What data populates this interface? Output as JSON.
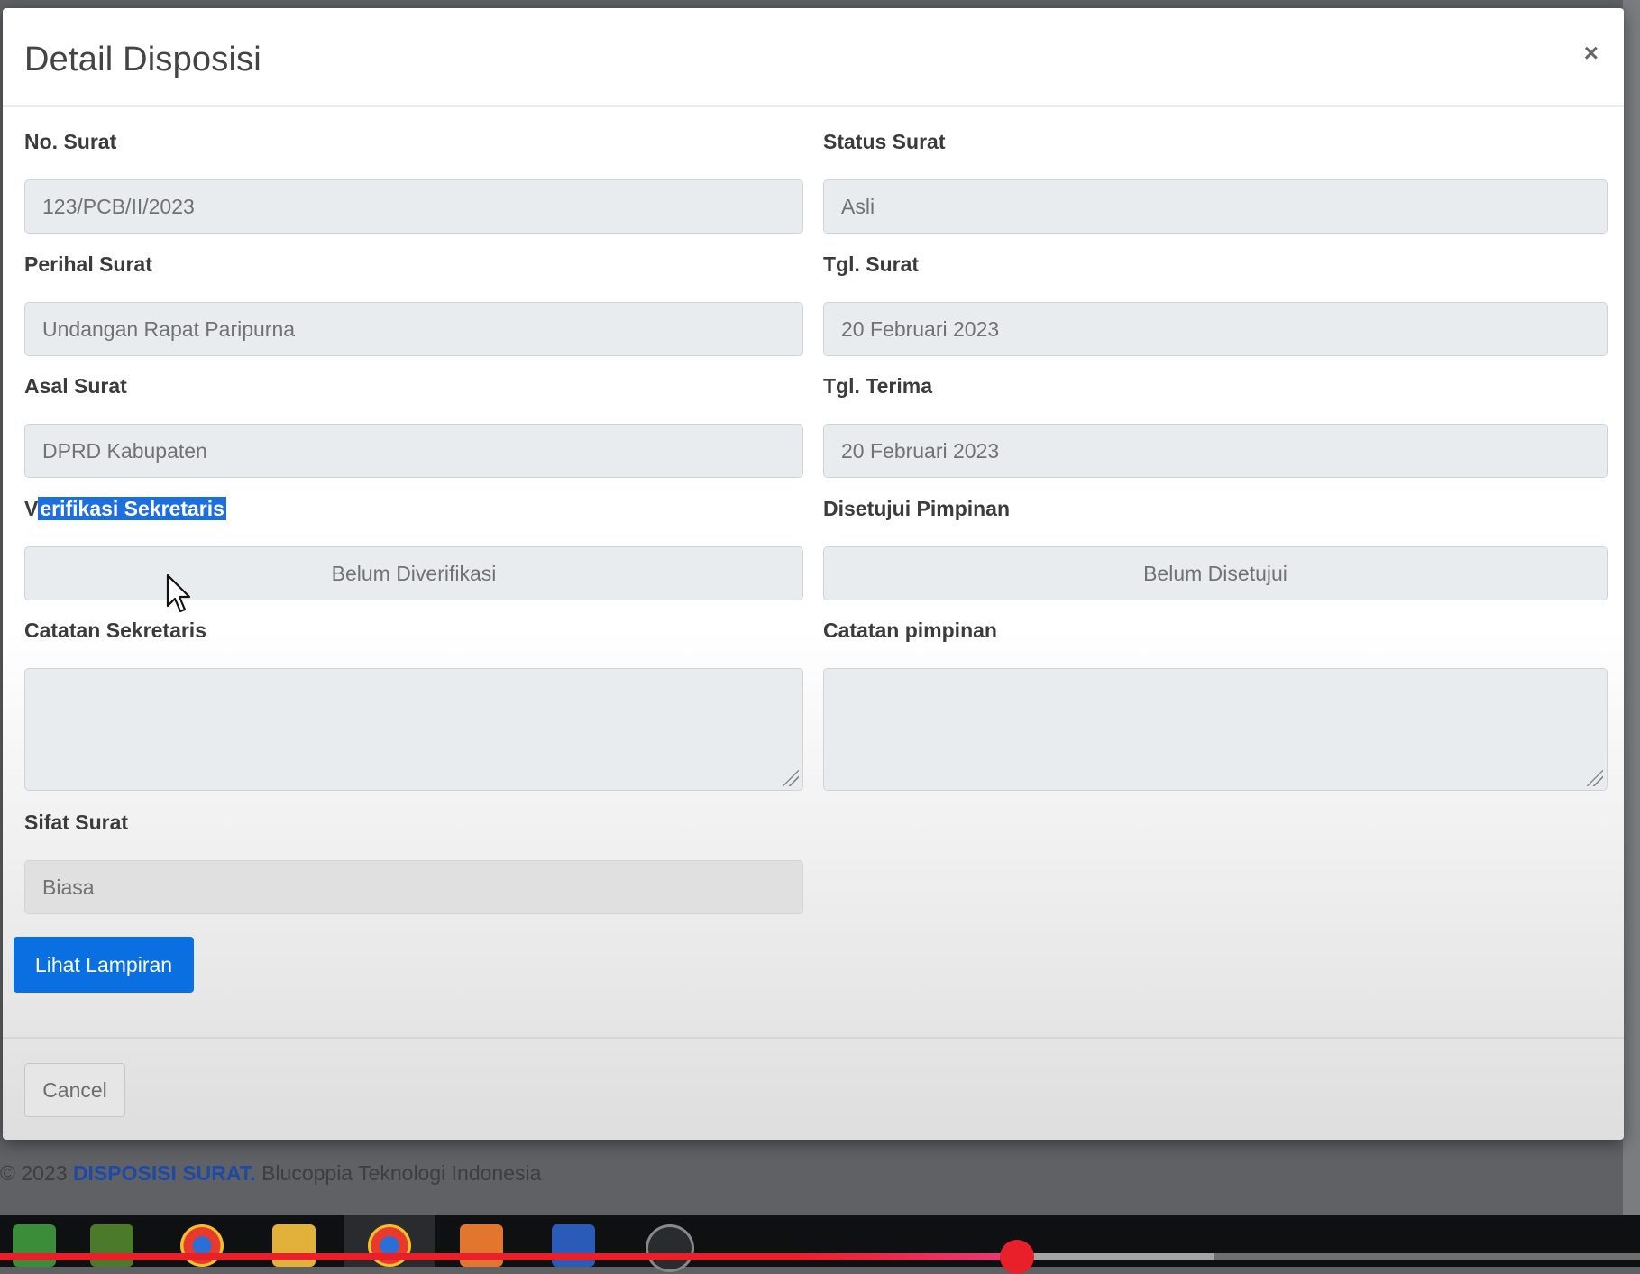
{
  "modal": {
    "title": "Detail Disposisi",
    "close_label": "×"
  },
  "fields": {
    "no_surat": {
      "label": "No. Surat",
      "value": "123/PCB/II/2023"
    },
    "status_surat": {
      "label": "Status Surat",
      "value": "Asli"
    },
    "perihal_surat": {
      "label": "Perihal Surat",
      "value": "Undangan Rapat Paripurna"
    },
    "tgl_surat": {
      "label": "Tgl. Surat",
      "value": "20 Februari 2023"
    },
    "asal_surat": {
      "label": "Asal Surat",
      "value": "DPRD Kabupaten"
    },
    "tgl_terima": {
      "label": "Tgl. Terima",
      "value": "20 Februari 2023"
    },
    "verifikasi_sekretaris": {
      "label_first": "V",
      "label_rest": "erifikasi Sekretaris",
      "value": "Belum Diverifikasi"
    },
    "disetujui_pimpinan": {
      "label": "Disetujui Pimpinan",
      "value": "Belum Disetujui"
    },
    "catatan_sekretaris": {
      "label": "Catatan Sekretaris",
      "value": ""
    },
    "catatan_pimpinan": {
      "label": "Catatan pimpinan",
      "value": ""
    },
    "sifat_surat": {
      "label": "Sifat Surat",
      "value": "Biasa"
    }
  },
  "buttons": {
    "lihat_lampiran": "Lihat Lampiran",
    "cancel": "Cancel"
  },
  "footer": {
    "copyright": "© 2023 ",
    "brand": "DISPOSISI SURAT.",
    "company": " Blucoppia Teknologi Indonesia"
  },
  "video": {
    "progress_fraction": 0.62,
    "buffered_fraction": 0.74
  },
  "colors": {
    "primary": "#0a6fe0",
    "selection": "#1f6ee0",
    "progress": "#e8202a"
  }
}
